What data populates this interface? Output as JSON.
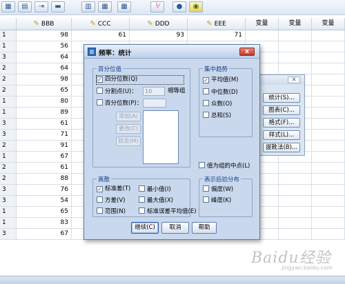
{
  "toolbar": {
    "icons": [
      "grid-icon",
      "split-table-icon",
      "select-cases-icon",
      "undo-icon",
      "table-icon",
      "value-labels-icon",
      "spell-check-icon",
      "circle-icon",
      "target-icon"
    ]
  },
  "grid": {
    "columns": [
      {
        "label": "BBB",
        "type": "var"
      },
      {
        "label": "CCC",
        "type": "var"
      },
      {
        "label": "DDD",
        "type": "var"
      },
      {
        "label": "EEE",
        "type": "var"
      },
      {
        "label": "变量",
        "type": "empty"
      },
      {
        "label": "变量",
        "type": "empty"
      },
      {
        "label": "变量",
        "type": "empty"
      }
    ],
    "rows": [
      {
        "n": "1",
        "bbb": "98",
        "ccc": "61",
        "ddd": "93",
        "eee": "71"
      },
      {
        "n": "1",
        "bbb": "56",
        "ccc": "",
        "ddd": "",
        "eee": ""
      },
      {
        "n": "3",
        "bbb": "64",
        "ccc": "",
        "ddd": "",
        "eee": ""
      },
      {
        "n": "2",
        "bbb": "64",
        "ccc": "",
        "ddd": "",
        "eee": ""
      },
      {
        "n": "2",
        "bbb": "98",
        "ccc": "",
        "ddd": "",
        "eee": ""
      },
      {
        "n": "2",
        "bbb": "65",
        "ccc": "",
        "ddd": "",
        "eee": ""
      },
      {
        "n": "1",
        "bbb": "80",
        "ccc": "",
        "ddd": "",
        "eee": ""
      },
      {
        "n": "1",
        "bbb": "89",
        "ccc": "",
        "ddd": "",
        "eee": ""
      },
      {
        "n": "3",
        "bbb": "61",
        "ccc": "",
        "ddd": "",
        "eee": ""
      },
      {
        "n": "3",
        "bbb": "71",
        "ccc": "",
        "ddd": "",
        "eee": ""
      },
      {
        "n": "2",
        "bbb": "91",
        "ccc": "",
        "ddd": "",
        "eee": ""
      },
      {
        "n": "1",
        "bbb": "67",
        "ccc": "",
        "ddd": "",
        "eee": ""
      },
      {
        "n": "2",
        "bbb": "61",
        "ccc": "",
        "ddd": "",
        "eee": ""
      },
      {
        "n": "2",
        "bbb": "88",
        "ccc": "",
        "ddd": "",
        "eee": ""
      },
      {
        "n": "3",
        "bbb": "76",
        "ccc": "",
        "ddd": "",
        "eee": ""
      },
      {
        "n": "3",
        "bbb": "54",
        "ccc": "",
        "ddd": "",
        "eee": ""
      },
      {
        "n": "1",
        "bbb": "65",
        "ccc": "",
        "ddd": "",
        "eee": ""
      },
      {
        "n": "1",
        "bbb": "83",
        "ccc": "",
        "ddd": "",
        "eee": ""
      },
      {
        "n": "3",
        "bbb": "67",
        "ccc": "",
        "ddd": "",
        "eee": ""
      }
    ]
  },
  "frequencies_panel": {
    "buttons": [
      "统计(S)...",
      "图表(C)...",
      "格式(F)...",
      "样式(L)...",
      "拔靴法(B)..."
    ]
  },
  "dialog": {
    "title": "频率：统计",
    "close_label": "x",
    "percentile": {
      "group_label": "百分位值",
      "quartiles": "四分位数(Q)",
      "cut_points": "分割点(U)：",
      "cut_points_value": "10",
      "equal_groups": "相等组",
      "percentiles": "百分位数(P)：",
      "add": "添加(A)",
      "change": "更改(C)",
      "remove": "除去(M)"
    },
    "central": {
      "group_label": "集中趋势",
      "mean": "平均值(M)",
      "median": "中位数(D)",
      "mode": "众数(O)",
      "sum": "总和(S)"
    },
    "midpoint": "值为组的中点(L)",
    "dispersion": {
      "group_label": "离散",
      "std": "标准差(T)",
      "min": "最小值(I)",
      "variance": "方差(V)",
      "max": "最大值(X)",
      "range": "范围(N)",
      "sem": "标准误差平均值(E)"
    },
    "distribution": {
      "group_label": "表示后验分布",
      "skewness": "偏度(W)",
      "kurtosis": "峰度(K)"
    },
    "continue": "继续(C)",
    "cancel": "取消",
    "help": "帮助"
  },
  "watermark": {
    "main": "Baidu经验",
    "sub": "jingyan.baidu.com"
  },
  "colors": {
    "dialog_bg": "#c9d8ec",
    "group_label": "#15408a",
    "close_red": "#c0392b",
    "pencil": "#c49a16"
  }
}
